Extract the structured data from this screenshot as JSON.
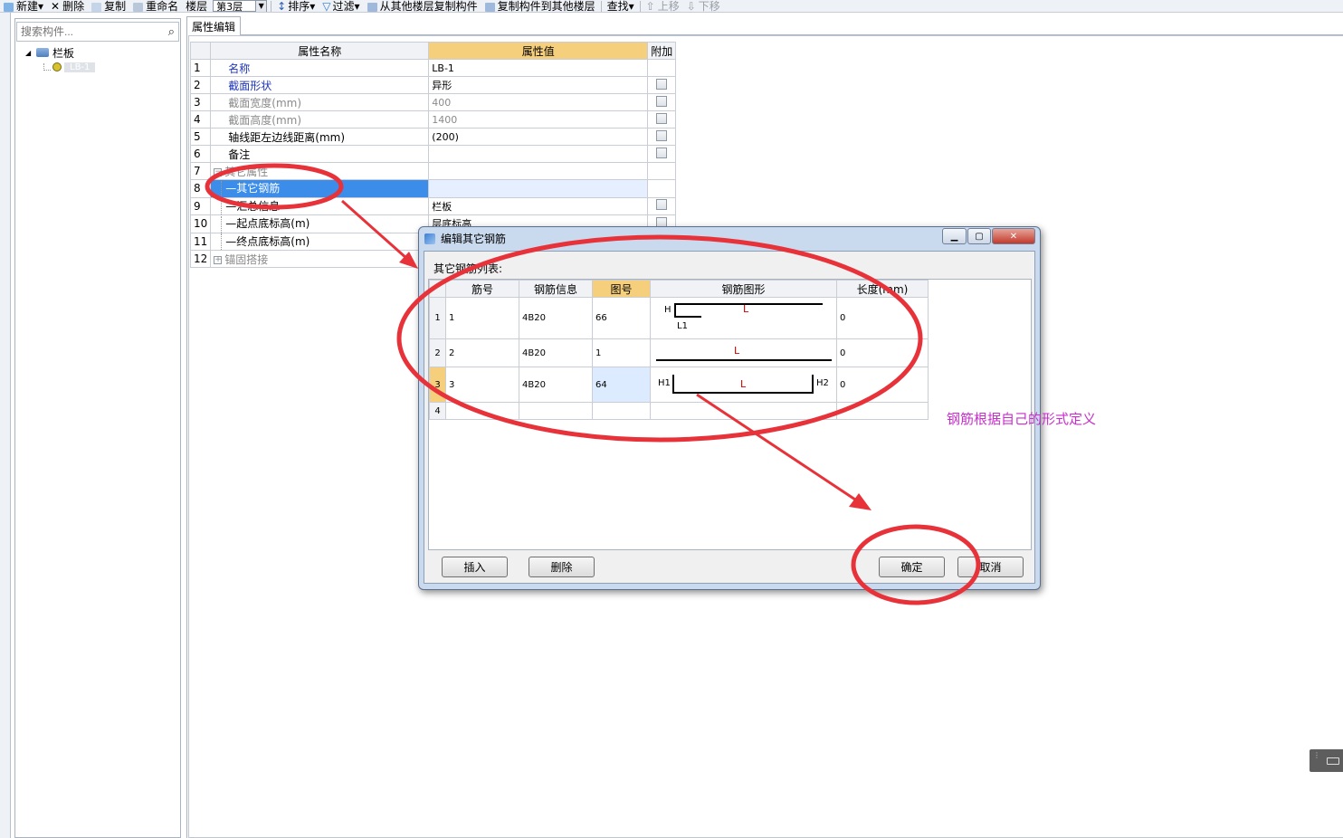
{
  "toolbar": {
    "new": "新建",
    "delete": "删除",
    "copy": "复制",
    "rename": "重命名",
    "floor_label": "楼层",
    "floor_value": "第3层",
    "sort": "排序",
    "filter": "过滤",
    "copy_from_floor": "从其他楼层复制构件",
    "copy_to_floor": "复制构件到其他楼层",
    "find": "查找",
    "move_up": "上移",
    "move_down": "下移"
  },
  "left": {
    "search_placeholder": "搜索构件...",
    "tree_root": "栏板",
    "tree_child": "LB-1"
  },
  "props": {
    "tab": "属性编辑",
    "headers": [
      "属性名称",
      "属性值",
      "附加"
    ],
    "rows": [
      {
        "n": "1",
        "name": "名称",
        "value": "LB-1"
      },
      {
        "n": "2",
        "name": "截面形状",
        "value": "异形"
      },
      {
        "n": "3",
        "name": "截面宽度(mm)",
        "value": "400"
      },
      {
        "n": "4",
        "name": "截面高度(mm)",
        "value": "1400"
      },
      {
        "n": "5",
        "name": "轴线距左边线距离(mm)",
        "value": "(200)"
      },
      {
        "n": "6",
        "name": "备注",
        "value": ""
      },
      {
        "n": "7",
        "name": "其它属性",
        "value": ""
      },
      {
        "n": "8",
        "name": "其它钢筋",
        "value": ""
      },
      {
        "n": "9",
        "name": "汇总信息",
        "value": "栏板"
      },
      {
        "n": "10",
        "name": "起点底标高(m)",
        "value": "层底标高"
      },
      {
        "n": "11",
        "name": "终点底标高(m)",
        "value": ""
      },
      {
        "n": "12",
        "name": "锚固搭接",
        "value": ""
      }
    ]
  },
  "dialog": {
    "title": "编辑其它钢筋",
    "list_label": "其它钢筋列表:",
    "headers": [
      "筋号",
      "钢筋信息",
      "图号",
      "钢筋图形",
      "长度(mm)"
    ],
    "rows": [
      {
        "n": "1",
        "bar_no": "1",
        "info": "4B20",
        "fig": "66",
        "length": "0"
      },
      {
        "n": "2",
        "bar_no": "2",
        "info": "4B20",
        "fig": "1",
        "length": "0"
      },
      {
        "n": "3",
        "bar_no": "3",
        "info": "4B20",
        "fig": "64",
        "length": "0"
      },
      {
        "n": "4",
        "bar_no": "",
        "info": "",
        "fig": "",
        "length": ""
      }
    ],
    "shape_labels": {
      "h": "H",
      "l": "L",
      "l1": "L1",
      "h1": "H1",
      "h2": "H2"
    },
    "buttons": {
      "insert": "插入",
      "delete": "删除",
      "ok": "确定",
      "cancel": "取消"
    }
  },
  "annotation": "钢筋根据自己的形式定义",
  "colors": {
    "annotation": "#c72fcb",
    "circle": "#e8323a",
    "header_highlight": "#f6cf7d",
    "selection": "#3b8de9"
  }
}
